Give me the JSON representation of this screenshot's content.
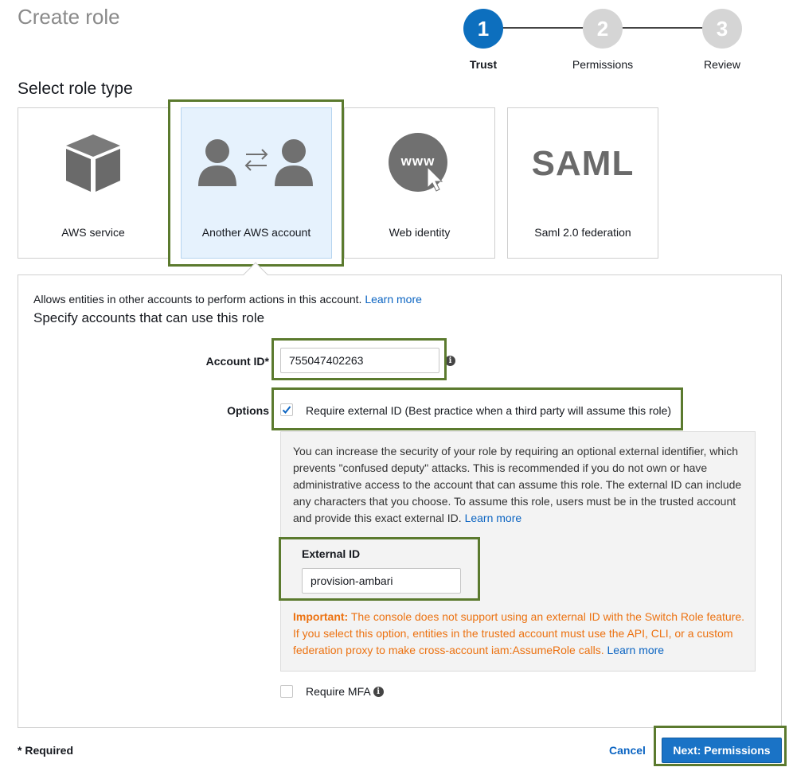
{
  "page": {
    "title": "Create role"
  },
  "steps": [
    {
      "number": "1",
      "label": "Trust"
    },
    {
      "number": "2",
      "label": "Permissions"
    },
    {
      "number": "3",
      "label": "Review"
    }
  ],
  "role_type": {
    "heading": "Select role type",
    "options": [
      {
        "label": "AWS service",
        "icon": "cube-icon"
      },
      {
        "label": "Another AWS account",
        "icon": "users-exchange-icon",
        "selected": true
      },
      {
        "label": "Web identity",
        "icon": "www-globe-icon",
        "icon_text": "www"
      },
      {
        "label": "Saml 2.0 federation",
        "icon": "saml-logo-icon",
        "icon_text": "SAML"
      }
    ]
  },
  "panel": {
    "description": "Allows entities in other accounts to perform actions in this account.",
    "learn_more": "Learn more",
    "subheading": "Specify accounts that can use this role",
    "account_id": {
      "label": "Account ID*",
      "value": "755047402263"
    },
    "options": {
      "label": "Options",
      "external_id_checkbox": {
        "label": "Require external ID (Best practice when a third party will assume this role)",
        "checked": true
      },
      "info_text": "You can increase the security of your role by requiring an optional external identifier, which prevents \"confused deputy\" attacks. This is recommended if you do not own or have administrative access to the account that can assume this role. The external ID can include any characters that you choose. To assume this role, users must be in the trusted account and provide this exact external ID.",
      "info_learn_more": "Learn more",
      "external_id": {
        "label": "External ID",
        "value": "provision-ambari"
      },
      "important_label": "Important:",
      "important_text": "The console does not support using an external ID with the Switch Role feature. If you select this option, entities in the trusted account must use the API, CLI, or a custom federation proxy to make cross-account iam:AssumeRole calls.",
      "important_learn_more": "Learn more",
      "mfa_checkbox": {
        "label": "Require MFA",
        "checked": false
      }
    }
  },
  "footer": {
    "required_note": "* Required",
    "cancel": "Cancel",
    "next": "Next: Permissions"
  },
  "colors": {
    "accent": "#0d6fbe",
    "highlight": "#5b7a2e",
    "warning": "#ec7211"
  }
}
